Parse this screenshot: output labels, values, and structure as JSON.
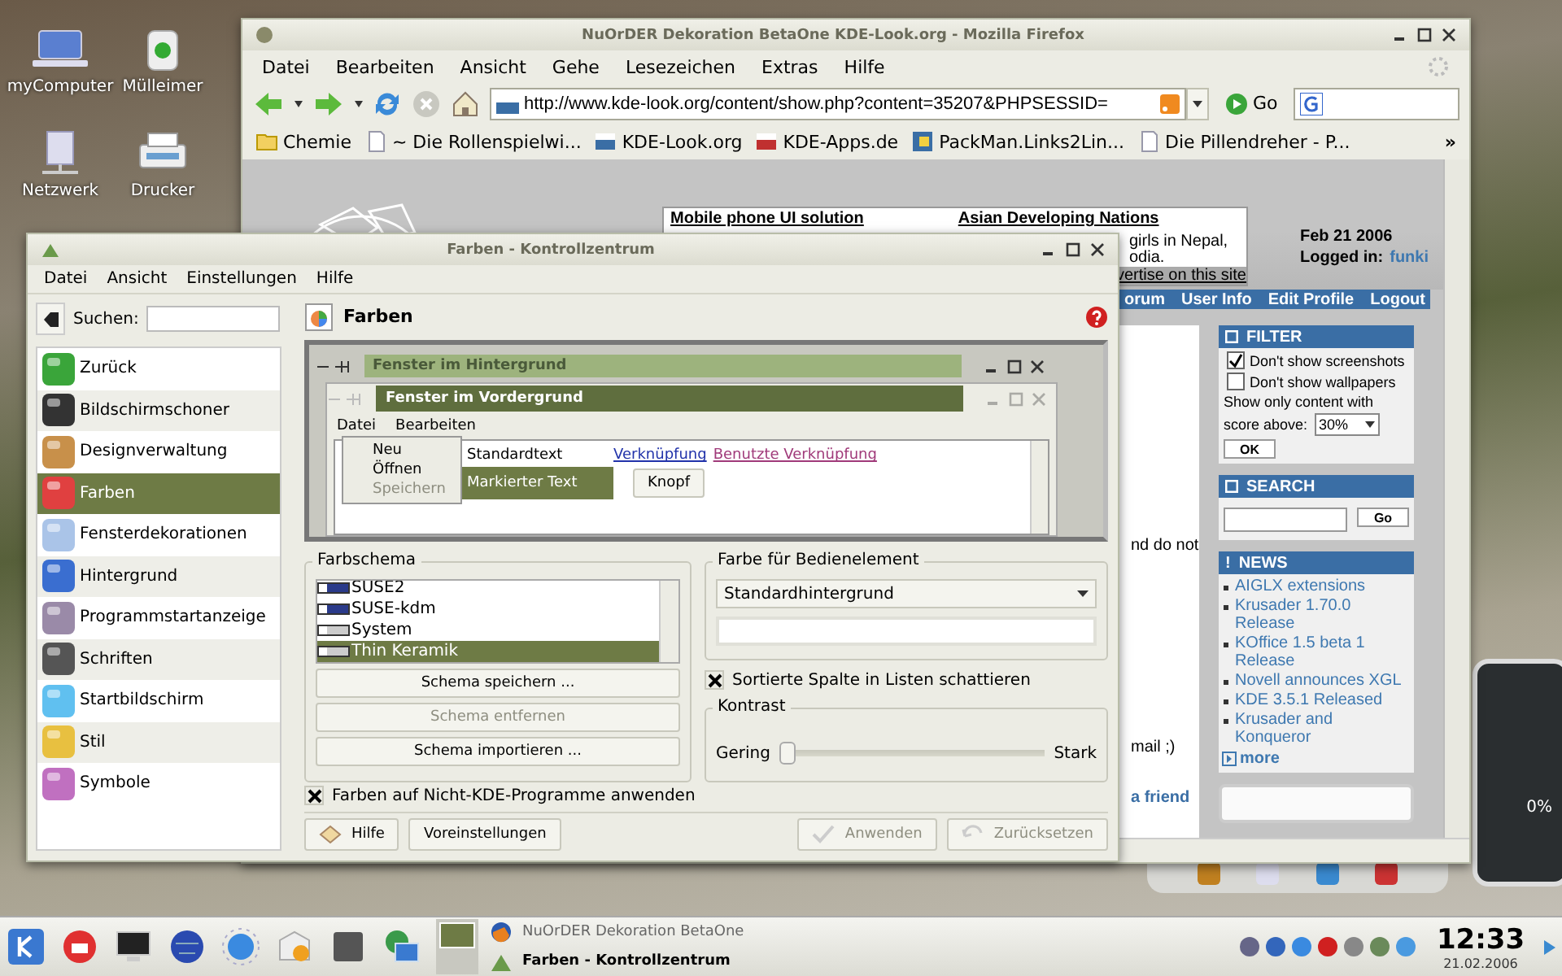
{
  "desktop": {
    "icons": [
      {
        "label": "myComputer"
      },
      {
        "label": "Mülleimer"
      },
      {
        "label": "Netzwerk"
      },
      {
        "label": "Drucker"
      }
    ],
    "widget_reading": "0%"
  },
  "firefox": {
    "title": "NuOrDER Dekoration BetaOne KDE-Look.org - Mozilla Firefox",
    "menu": [
      "Datei",
      "Bearbeiten",
      "Ansicht",
      "Gehe",
      "Lesezeichen",
      "Extras",
      "Hilfe"
    ],
    "url": "http://www.kde-look.org/content/show.php?content=35207&PHPSESSID=",
    "go": "Go",
    "bookmarks": [
      "Chemie",
      "~ Die Rollenspielwi...",
      "KDE-Look.org",
      "KDE-Apps.de",
      "PackMan.Links2Lin...",
      "Die Pillendreher - P..."
    ],
    "overflow": "»",
    "page": {
      "ads": [
        "Mobile phone UI solution",
        "Asian Developing Nations"
      ],
      "ad_lines": [
        "girls in Nepal,",
        "odia."
      ],
      "advertise": "vertise on this site",
      "date": "Feb 21 2006",
      "login_label": "Logged in:",
      "user": "funki",
      "nav": [
        "orum",
        "User Info",
        "Edit Profile",
        "Logout"
      ],
      "fragments": [
        "nd do not",
        "mail ;)",
        "a friend"
      ],
      "filter": {
        "title": "FILTER",
        "options": [
          {
            "label": "Don't show screenshots",
            "checked": true
          },
          {
            "label": "Don't show wallpapers",
            "checked": false
          }
        ],
        "score_label": "Show only content with",
        "score_prefix": "score above:",
        "score": "30%",
        "button": "OK"
      },
      "search": {
        "title": "SEARCH",
        "button": "Go"
      },
      "news": {
        "mark": "!",
        "title": "NEWS",
        "items": [
          "AIGLX extensions",
          "Krusader 1.70.0 Release",
          "KOffice 1.5 beta 1 Release",
          "Novell announces XGL",
          "KDE 3.5.1 Released",
          "Krusader and Konqueror"
        ],
        "more": "more"
      }
    }
  },
  "control_center": {
    "title": "Farben - Kontrollzentrum",
    "menu": [
      "Datei",
      "Ansicht",
      "Einstellungen",
      "Hilfe"
    ],
    "search_label": "Suchen:",
    "modules": [
      {
        "label": "Zurück",
        "selected": false
      },
      {
        "label": "Bildschirmschoner",
        "selected": false
      },
      {
        "label": "Designverwaltung",
        "selected": false
      },
      {
        "label": "Farben",
        "selected": true
      },
      {
        "label": "Fensterdekorationen",
        "selected": false
      },
      {
        "label": "Hintergrund",
        "selected": false
      },
      {
        "label": "Programmstartanzeige",
        "selected": false
      },
      {
        "label": "Schriften",
        "selected": false
      },
      {
        "label": "Startbildschirm",
        "selected": false
      },
      {
        "label": "Stil",
        "selected": false
      },
      {
        "label": "Symbole",
        "selected": false
      }
    ],
    "header": "Farben",
    "preview": {
      "inactive_title": "Fenster im Hintergrund",
      "active_title": "Fenster im Vordergrund",
      "menu": [
        "Datei",
        "Bearbeiten"
      ],
      "popup": [
        {
          "label": "Neu",
          "disabled": false
        },
        {
          "label": "Öffnen",
          "disabled": false
        },
        {
          "label": "Speichern",
          "disabled": true
        }
      ],
      "standard_text": "Standardtext",
      "selected_text": "Markierter Text",
      "button": "Knopf",
      "link": "Verknüpfung",
      "visited_link": "Benutzte Verknüpfung"
    },
    "scheme_group": {
      "title": "Farbschema",
      "schemes": [
        {
          "label": "SUSE2",
          "selected": false
        },
        {
          "label": "SUSE-kdm",
          "selected": false
        },
        {
          "label": "System",
          "selected": false
        },
        {
          "label": "Thin Keramik",
          "selected": true
        }
      ],
      "buttons": [
        {
          "label": "Schema speichern ...",
          "disabled": false
        },
        {
          "label": "Schema entfernen",
          "disabled": true
        },
        {
          "label": "Schema importieren ...",
          "disabled": false
        }
      ]
    },
    "widget_group": {
      "title": "Farbe für Bedienelement",
      "value": "Standardhintergrund"
    },
    "shade_sorted": {
      "label": "Sortierte Spalte in Listen schattieren",
      "checked": true
    },
    "contrast": {
      "title": "Kontrast",
      "low": "Gering",
      "high": "Stark",
      "level": 0
    },
    "apply_nonkde": {
      "label": "Farben auf Nicht-KDE-Programme anwenden",
      "checked": true
    },
    "buttons": [
      {
        "label": "Hilfe",
        "disabled": false
      },
      {
        "label": "Voreinstellungen",
        "disabled": false
      },
      {
        "label": "Anwenden",
        "disabled": true
      },
      {
        "label": "Zurücksetzen",
        "disabled": true
      }
    ]
  },
  "taskbar": {
    "tasks": [
      {
        "label": "NuOrDER Dekoration BetaOne",
        "active": false
      },
      {
        "label": "Farben - Kontrollzentrum",
        "active": true
      }
    ],
    "clock": "12:33",
    "date": "21.02.2006"
  }
}
